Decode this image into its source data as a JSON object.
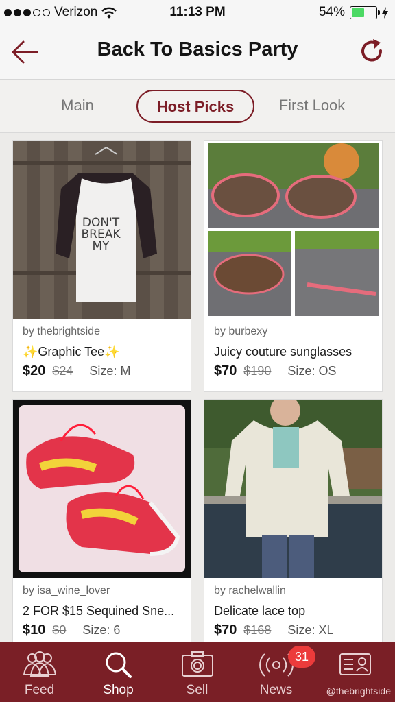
{
  "status_bar": {
    "carrier": "Verizon",
    "time": "11:13 PM",
    "battery": "54%"
  },
  "nav": {
    "title": "Back To Basics Party"
  },
  "tabs": {
    "main": "Main",
    "host_picks": "Host Picks",
    "first_look": "First Look",
    "selected": "Host Picks"
  },
  "listings": [
    {
      "seller": "by thebrightside",
      "title": "✨Graphic Tee✨",
      "price": "$20",
      "original_price": "$24",
      "size": "Size: M",
      "image_text": "DON'T BREAK MY"
    },
    {
      "seller": "by burbexy",
      "title": "Juicy couture sunglasses",
      "price": "$70",
      "original_price": "$190",
      "size": "Size: OS"
    },
    {
      "seller": "by isa_wine_lover",
      "title": "2 FOR $15 Sequined Sne...",
      "price": "$10",
      "original_price": "$0",
      "size": "Size: 6"
    },
    {
      "seller": "by rachelwallin",
      "title": "Delicate lace top",
      "price": "$70",
      "original_price": "$168",
      "size": "Size: XL"
    }
  ],
  "tabbar": {
    "items": [
      {
        "label": "Feed",
        "icon": "people-icon"
      },
      {
        "label": "Shop",
        "icon": "search-icon"
      },
      {
        "label": "Sell",
        "icon": "camera-icon"
      },
      {
        "label": "News",
        "icon": "broadcast-icon"
      },
      {
        "label": "",
        "icon": "profile-card-icon"
      }
    ],
    "news_badge": "31",
    "watermark": "@thebrightside"
  },
  "colors": {
    "brand": "#7a1f26",
    "badge": "#ec3b3b",
    "battery": "#4cd964"
  }
}
